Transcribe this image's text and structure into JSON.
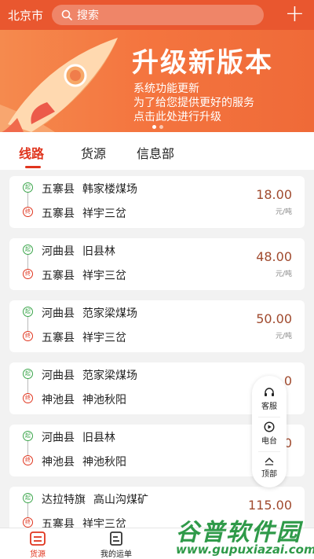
{
  "header": {
    "city": "北京市",
    "search_placeholder": "搜索",
    "add_label": "+"
  },
  "banner": {
    "title": "升级新版本",
    "lines": [
      "系统功能更新",
      "为了给您提供更好的服务",
      "点击此处进行升级"
    ],
    "slide_count": 2,
    "active_slide": 1
  },
  "tabs": [
    {
      "label": "线路",
      "active": true
    },
    {
      "label": "货源",
      "active": false
    },
    {
      "label": "信息部",
      "active": false
    }
  ],
  "route_labels": {
    "start": "起",
    "end": "终",
    "unit": "元/吨"
  },
  "routes": [
    {
      "from_county": "五寨县",
      "from_place": "韩家楼煤场",
      "to_county": "五寨县",
      "to_place": "祥宇三岔",
      "price": "18.00"
    },
    {
      "from_county": "河曲县",
      "from_place": "旧县林",
      "to_county": "五寨县",
      "to_place": "祥宇三岔",
      "price": "48.00"
    },
    {
      "from_county": "河曲县",
      "from_place": "范家梁煤场",
      "to_county": "五寨县",
      "to_place": "祥宇三岔",
      "price": "50.00"
    },
    {
      "from_county": "河曲县",
      "from_place": "范家梁煤场",
      "to_county": "神池县",
      "to_place": "神池秋阳",
      "price": ".0"
    },
    {
      "from_county": "河曲县",
      "from_place": "旧县林",
      "to_county": "神池县",
      "to_place": "神池秋阳",
      "price": ".0"
    },
    {
      "from_county": "达拉特旗",
      "from_place": "高山沟煤矿",
      "to_county": "五寨县",
      "to_place": "祥宇三岔",
      "price": "115.00"
    }
  ],
  "float_menu": {
    "service": "客服",
    "radio": "电台",
    "top": "顶部"
  },
  "bottom_nav": [
    {
      "label": "货源",
      "active": true
    },
    {
      "label": "我的运单",
      "active": false
    }
  ],
  "watermark": {
    "big": "谷普软件园",
    "small": "www.gupuxiazai.com"
  },
  "colors": {
    "brand": "#e9572f",
    "accent": "#e0351e",
    "price": "#a04a2e",
    "start_pin": "#3aa54a"
  }
}
